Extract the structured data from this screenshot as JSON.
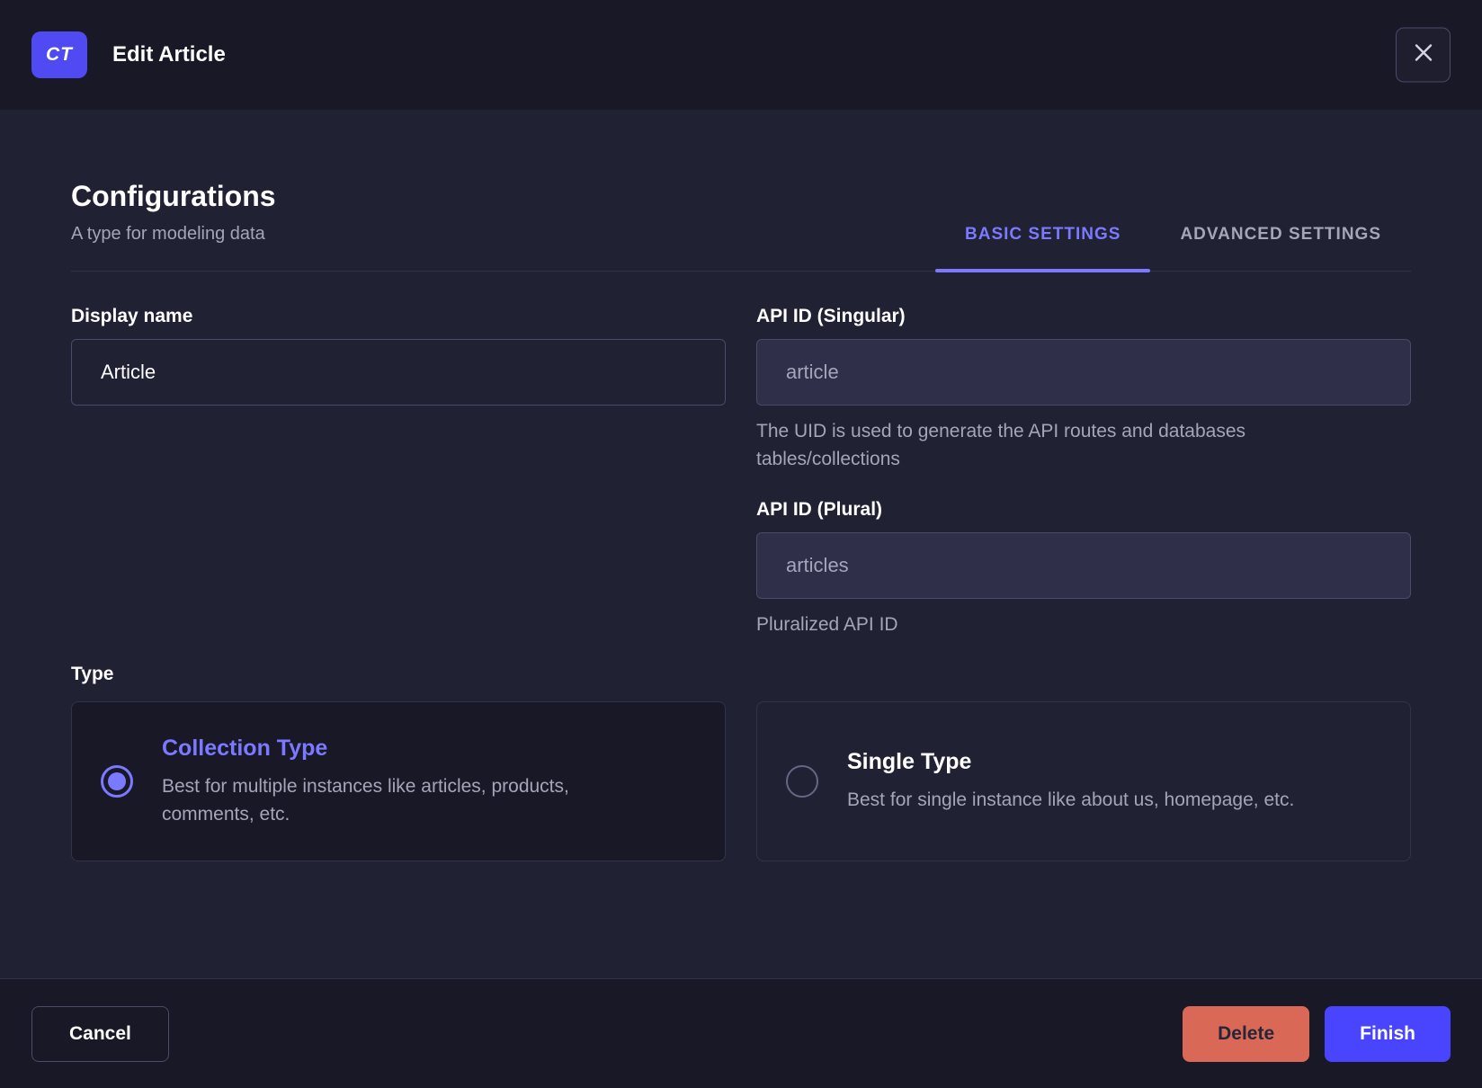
{
  "header": {
    "badge": "CT",
    "title": "Edit Article"
  },
  "config": {
    "title": "Configurations",
    "subtitle": "A type for modeling data",
    "tabs": [
      {
        "label": "BASIC SETTINGS",
        "active": true
      },
      {
        "label": "ADVANCED SETTINGS",
        "active": false
      }
    ]
  },
  "form": {
    "display_name": {
      "label": "Display name",
      "value": "Article"
    },
    "api_id_singular": {
      "label": "API ID (Singular)",
      "value": "article",
      "helper": "The UID is used to generate the API routes and databases tables/collections"
    },
    "api_id_plural": {
      "label": "API ID (Plural)",
      "value": "articles",
      "helper": "Pluralized API ID"
    }
  },
  "type": {
    "label": "Type",
    "options": [
      {
        "title": "Collection Type",
        "description": "Best for multiple instances like articles, products, comments, etc.",
        "selected": true
      },
      {
        "title": "Single Type",
        "description": "Best for single instance like about us, homepage, etc.",
        "selected": false
      }
    ]
  },
  "footer": {
    "cancel_label": "Cancel",
    "delete_label": "Delete",
    "finish_label": "Finish"
  },
  "colors": {
    "accent": "#4945ff",
    "accent_light": "#7b79ff",
    "danger": "#d96856",
    "background": "#212134",
    "surface_dark": "#181826"
  }
}
